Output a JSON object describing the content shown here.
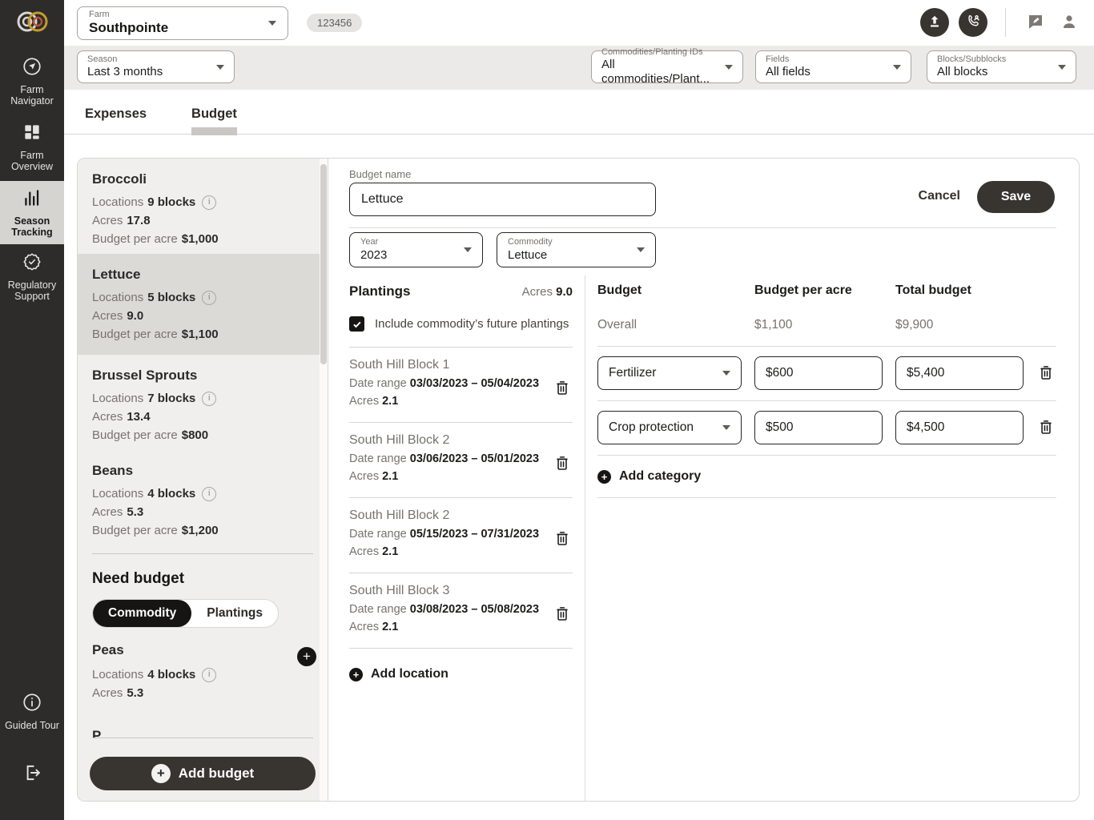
{
  "labels": {
    "locations": "Locations",
    "acres": "Acres",
    "budget_per_acre": "Budget per acre",
    "date_range": "Date range"
  },
  "header": {
    "farm_label": "Farm",
    "farm_value": "Southpointe",
    "badge": "123456"
  },
  "sidebar": {
    "items": [
      {
        "label": "Farm Navigator"
      },
      {
        "label": "Farm Overview"
      },
      {
        "label": "Season Tracking"
      },
      {
        "label": "Regulatory Support"
      }
    ],
    "guided_tour_label": "Guided Tour"
  },
  "filters": {
    "season": {
      "label": "Season",
      "value": "Last 3 months"
    },
    "commodities": {
      "label": "Commodities/Planting IDs",
      "value": "All commodities/Plant..."
    },
    "fields": {
      "label": "Fields",
      "value": "All fields"
    },
    "blocks": {
      "label": "Blocks/Subblocks",
      "value": "All blocks"
    }
  },
  "tabs": {
    "expenses": "Expenses",
    "budget": "Budget"
  },
  "budget_list": {
    "items": [
      {
        "name": "Broccoli",
        "locations": "9 blocks",
        "acres": "17.8",
        "budget_per_acre": "$1,000"
      },
      {
        "name": "Lettuce",
        "locations": "5 blocks",
        "acres": "9.0",
        "budget_per_acre": "$1,100"
      },
      {
        "name": "Brussel Sprouts",
        "locations": "7 blocks",
        "acres": "13.4",
        "budget_per_acre": "$800"
      },
      {
        "name": "Beans",
        "locations": "4 blocks",
        "acres": "5.3",
        "budget_per_acre": "$1,200"
      }
    ],
    "need_budget": {
      "title": "Need budget",
      "toggle_commodity": "Commodity",
      "toggle_plantings": "Plantings",
      "items": [
        {
          "name": "Peas",
          "locations": "4 blocks",
          "acres": "5.3"
        }
      ],
      "partial_item_fragment": "P"
    },
    "add_budget_label": "Add budget"
  },
  "editor": {
    "budget_name_label": "Budget name",
    "budget_name_value": "Lettuce",
    "cancel_label": "Cancel",
    "save_label": "Save",
    "year": {
      "label": "Year",
      "value": "2023"
    },
    "commodity": {
      "label": "Commodity",
      "value": "Lettuce"
    },
    "plantings": {
      "title": "Plantings",
      "acres_total": "9.0",
      "include_future_label": "Include commodity’s future plantings",
      "items": [
        {
          "name": "South Hill Block 1",
          "date_range": "03/03/2023 – 05/04/2023",
          "acres": "2.1"
        },
        {
          "name": "South Hill Block 2",
          "date_range": "03/06/2023 – 05/01/2023",
          "acres": "2.1"
        },
        {
          "name": "South Hill Block 2",
          "date_range": "05/15/2023 – 07/31/2023",
          "acres": "2.1"
        },
        {
          "name": "South Hill Block 3",
          "date_range": "03/08/2023 – 05/08/2023",
          "acres": "2.1"
        }
      ],
      "add_location_label": "Add location"
    },
    "budget_table": {
      "header_budget": "Budget",
      "header_per_acre": "Budget per acre",
      "header_total": "Total budget",
      "overall_label": "Overall",
      "overall_per_acre": "$1,100",
      "overall_total": "$9,900",
      "categories": [
        {
          "name": "Fertilizer",
          "per_acre": "$600",
          "total": "$5,400"
        },
        {
          "name": "Crop protection",
          "per_acre": "$500",
          "total": "$4,500"
        }
      ],
      "add_category_label": "Add category"
    }
  }
}
